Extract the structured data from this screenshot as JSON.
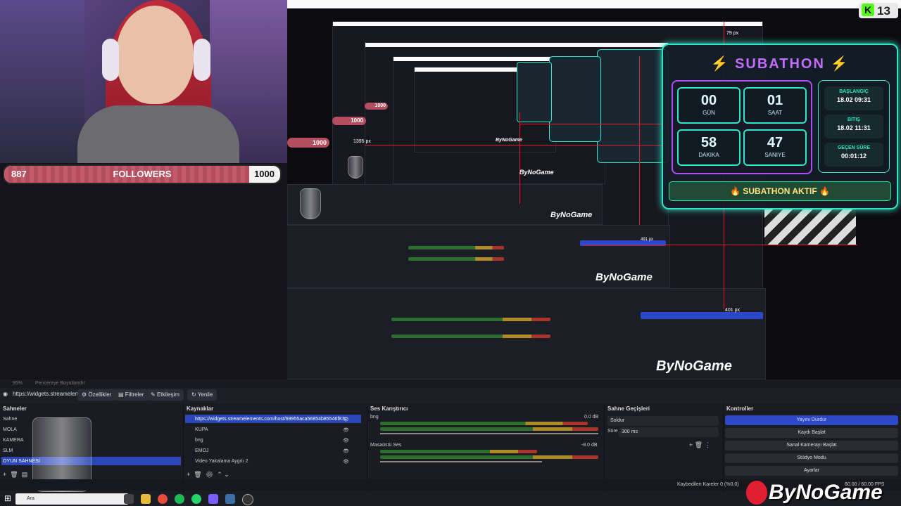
{
  "followers": {
    "current": "887",
    "label": "FOLLOWERS",
    "goal": "1000",
    "progress": 0.887
  },
  "kick": {
    "count": "13"
  },
  "subathon": {
    "title": "SUBATHON",
    "timer": [
      {
        "value": "00",
        "unit": "GÜN"
      },
      {
        "value": "01",
        "unit": "SAAT"
      },
      {
        "value": "58",
        "unit": "DAKIKA"
      },
      {
        "value": "47",
        "unit": "SANIYE"
      }
    ],
    "info": [
      {
        "key": "BAŞLANGIÇ",
        "value": "18.02 09:31"
      },
      {
        "key": "BITIŞ",
        "value": "18.02 11:31"
      },
      {
        "key": "GEÇEN SÜRE",
        "value": "00:01:12"
      }
    ],
    "status": "🔥 SUBATHON AKTIF 🔥"
  },
  "preview": {
    "labels": {
      "px79": "79 px",
      "px1395": "1395 px",
      "px491": "491 px",
      "px401": "401 px"
    },
    "nested_followers": [
      "1000",
      "1000",
      "1000"
    ]
  },
  "obs": {
    "zoom": "95%",
    "window_label": "Pencereye Boyutlandır",
    "toolbar": {
      "url": "https://widgets.streamelen",
      "properties": "Özellikler",
      "filters": "Filtreler",
      "interact": "Etkileşim",
      "refresh": "Yenile"
    },
    "scenes": {
      "title": "Sahneler",
      "items": [
        "Sahne",
        "MOLA",
        "KAMERA",
        "SLM",
        "OYUN SAHNESİ"
      ],
      "selected_index": 4
    },
    "sources": {
      "title": "Kaynaklar",
      "items": [
        "https://widgets.streamelements.com/host/69955aca56854b85546f87c",
        "KUPA",
        "bng",
        "EMOJ",
        "Video Yakalama Aygıtı 2"
      ]
    },
    "mixer": {
      "title": "Ses Karıştırıcı",
      "channels": [
        {
          "name": "bng",
          "db": "0.0 dB",
          "level": 0.95
        },
        {
          "name": "Masaüstü Ses",
          "db": "-8.0 dB",
          "level": 0.72
        }
      ]
    },
    "transitions": {
      "title": "Sahne Geçişleri",
      "type": "Soldur",
      "duration_label": "Süre",
      "duration": "300 ms"
    },
    "controls": {
      "title": "Kontroller",
      "buttons": [
        "Yayını Durdur",
        "Kaydı Başlat",
        "Sanal Kamerayı Başlat",
        "Stüdyo Modu",
        "Ayarlar"
      ]
    },
    "status": {
      "dropped": "Kaybedilen Kareler 0 (%0.0)",
      "fps": "60.00 / 60.00 FPS"
    },
    "taskbar": {
      "search": "Ara"
    }
  },
  "brand": {
    "name": "ByNoGame"
  },
  "colors": {
    "accent": "#2ee6c8",
    "purple": "#b04cff",
    "obs_blue": "#2c48c8",
    "red": "#e02030"
  }
}
